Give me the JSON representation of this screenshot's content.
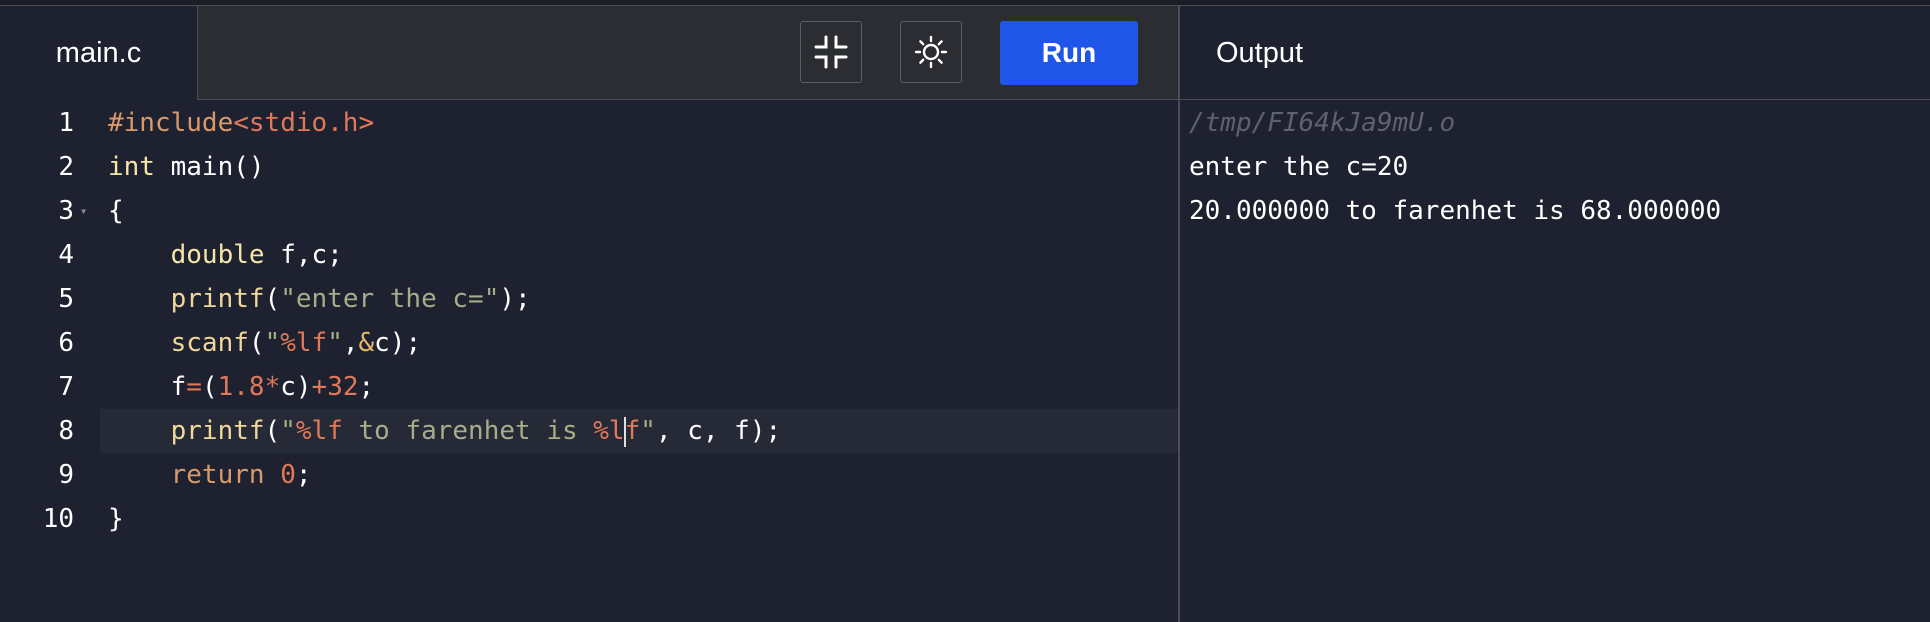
{
  "editor": {
    "tab_label": "main.c",
    "lines": [
      {
        "number": "1",
        "tokens": [
          {
            "cls": "pp",
            "text": "#include"
          },
          {
            "cls": "num",
            "text": "<stdio.h>"
          }
        ]
      },
      {
        "number": "2",
        "tokens": [
          {
            "cls": "kw",
            "text": "int"
          },
          {
            "cls": "",
            "text": " main()"
          }
        ]
      },
      {
        "number": "3",
        "tokens": [
          {
            "cls": "",
            "text": "{"
          }
        ]
      },
      {
        "number": "4",
        "tokens": [
          {
            "cls": "",
            "text": "    "
          },
          {
            "cls": "kw",
            "text": "double"
          },
          {
            "cls": "",
            "text": " f,c;"
          }
        ]
      },
      {
        "number": "5",
        "tokens": [
          {
            "cls": "",
            "text": "    "
          },
          {
            "cls": "fn",
            "text": "printf"
          },
          {
            "cls": "",
            "text": "("
          },
          {
            "cls": "str",
            "text": "\"enter the c=\""
          },
          {
            "cls": "",
            "text": ");"
          }
        ]
      },
      {
        "number": "6",
        "tokens": [
          {
            "cls": "",
            "text": "    "
          },
          {
            "cls": "fn",
            "text": "scanf"
          },
          {
            "cls": "",
            "text": "("
          },
          {
            "cls": "str",
            "text": "\""
          },
          {
            "cls": "num",
            "text": "%lf"
          },
          {
            "cls": "str",
            "text": "\""
          },
          {
            "cls": "",
            "text": ","
          },
          {
            "cls": "amp",
            "text": "&"
          },
          {
            "cls": "",
            "text": "c);"
          }
        ]
      },
      {
        "number": "7",
        "tokens": [
          {
            "cls": "",
            "text": "    f"
          },
          {
            "cls": "op",
            "text": "="
          },
          {
            "cls": "",
            "text": "("
          },
          {
            "cls": "num",
            "text": "1.8"
          },
          {
            "cls": "op",
            "text": "*"
          },
          {
            "cls": "",
            "text": "c)"
          },
          {
            "cls": "op",
            "text": "+"
          },
          {
            "cls": "num",
            "text": "32"
          },
          {
            "cls": "",
            "text": ";"
          }
        ]
      },
      {
        "number": "8",
        "tokens": [
          {
            "cls": "",
            "text": "    "
          },
          {
            "cls": "fn",
            "text": "printf"
          },
          {
            "cls": "",
            "text": "("
          },
          {
            "cls": "str",
            "text": "\""
          },
          {
            "cls": "num",
            "text": "%lf"
          },
          {
            "cls": "str",
            "text": " to farenhet is "
          },
          {
            "cls": "num",
            "text": "%l"
          },
          {
            "cls": "caret",
            "text": ""
          },
          {
            "cls": "num",
            "text": "f"
          },
          {
            "cls": "str",
            "text": "\""
          },
          {
            "cls": "",
            "text": ", c, f);"
          }
        ]
      },
      {
        "number": "9",
        "tokens": [
          {
            "cls": "",
            "text": "    "
          },
          {
            "cls": "pp",
            "text": "return"
          },
          {
            "cls": "",
            "text": " "
          },
          {
            "cls": "num",
            "text": "0"
          },
          {
            "cls": "",
            "text": ";"
          }
        ]
      },
      {
        "number": "10",
        "tokens": [
          {
            "cls": "",
            "text": "}"
          }
        ]
      }
    ],
    "fold_marker": "▾"
  },
  "toolbar": {
    "run_label": "Run",
    "fullscreen_icon": "exit-fullscreen-icon",
    "theme_icon": "sun-icon"
  },
  "output": {
    "title": "Output",
    "lines": [
      "/tmp/FI64kJa9mU.o",
      "enter the c=20",
      "20.000000 to farenhet is 68.000000"
    ]
  }
}
